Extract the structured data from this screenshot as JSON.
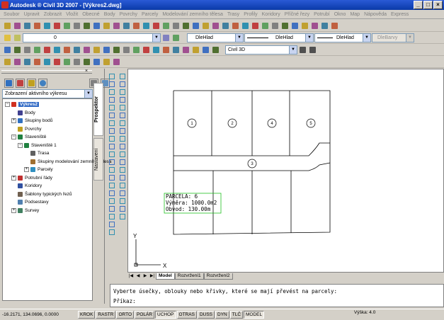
{
  "window": {
    "title": "Autodesk ® Civil 3D 2007 - [Výkres2.dwg]",
    "buttons": [
      "_",
      "□",
      "×"
    ]
  },
  "menu": [
    "Soubor",
    "Upravit",
    "Zobrazit",
    "Vložit",
    "Obecné",
    "Body",
    "Povrchy",
    "Parcely",
    "Modelování zemního tělesa",
    "Trasy",
    "Profily",
    "Koridory",
    "Příčné řezy",
    "Potrubí",
    "Okno",
    "Map",
    "Nápověda",
    "Express"
  ],
  "toolbar": {
    "layer_value": "0",
    "color_value": "DleHlad",
    "linetype_value": "DleHlad",
    "lineweight_value": "DleHlad",
    "plotstyle_value": "DleBarvy",
    "workspace_value": "Civil 3D"
  },
  "prospector": {
    "view_select": "Zobrazení aktivního výkresu",
    "tabs": [
      "Prospektor",
      "Nastavení"
    ],
    "tree": [
      {
        "label": "Výkres2",
        "level": 0,
        "color": "#d03020",
        "expand": "−",
        "selected": true
      },
      {
        "label": "Body",
        "level": 1,
        "color": "#404090",
        "expand": ""
      },
      {
        "label": "Skupiny bodů",
        "level": 1,
        "color": "#3070c0",
        "expand": "+"
      },
      {
        "label": "Povrchy",
        "level": 1,
        "color": "#c0a020",
        "expand": ""
      },
      {
        "label": "Staveniště",
        "level": 1,
        "color": "#208040",
        "expand": "−"
      },
      {
        "label": "Staveniště 1",
        "level": 2,
        "color": "#208040",
        "expand": "−"
      },
      {
        "label": "Trasa",
        "level": 3,
        "color": "#606060",
        "expand": ""
      },
      {
        "label": "Skupiny modelování zemního tělesa",
        "level": 3,
        "color": "#a07030",
        "expand": ""
      },
      {
        "label": "Parcely",
        "level": 3,
        "color": "#3090c0",
        "expand": "+"
      },
      {
        "label": "Potrubní řády",
        "level": 1,
        "color": "#c03030",
        "expand": "+"
      },
      {
        "label": "Koridory",
        "level": 1,
        "color": "#3050a0",
        "expand": ""
      },
      {
        "label": "Šablony typických řezů",
        "level": 1,
        "color": "#706050",
        "expand": ""
      },
      {
        "label": "Podsestavy",
        "level": 1,
        "color": "#5080b0",
        "expand": ""
      },
      {
        "label": "Survey",
        "level": 1,
        "color": "#408060",
        "expand": "+"
      }
    ]
  },
  "drawing": {
    "parcel_numbers": [
      "1",
      "2",
      "4",
      "5",
      "3"
    ],
    "parcel_info": [
      "PARCELA: 6",
      "Výměra: 1000.0m2",
      "Obvod: 130.00m"
    ],
    "ucs_x": "X",
    "ucs_y": "Y"
  },
  "layout_tabs": [
    "Model",
    "Rozvržení1",
    "Rozvržení2"
  ],
  "command": {
    "history": "Vyberte úsečky, oblouky nebo křivky, které se mají převést na parcely:",
    "prompt": "Příkaz:"
  },
  "status": {
    "coords": "-16.2171, 134.0696, 0.0000",
    "buttons": [
      {
        "label": "KROK",
        "on": false
      },
      {
        "label": "RASTR",
        "on": false
      },
      {
        "label": "ORTO",
        "on": false
      },
      {
        "label": "POLÁR",
        "on": false
      },
      {
        "label": "UCHOP",
        "on": true
      },
      {
        "label": "OTRAS",
        "on": false
      },
      {
        "label": "DUSS",
        "on": false
      },
      {
        "label": "DYN",
        "on": false
      },
      {
        "label": "TLČ",
        "on": false
      },
      {
        "label": "MODEL",
        "on": true
      }
    ],
    "scale": "Výška: 4.0"
  }
}
